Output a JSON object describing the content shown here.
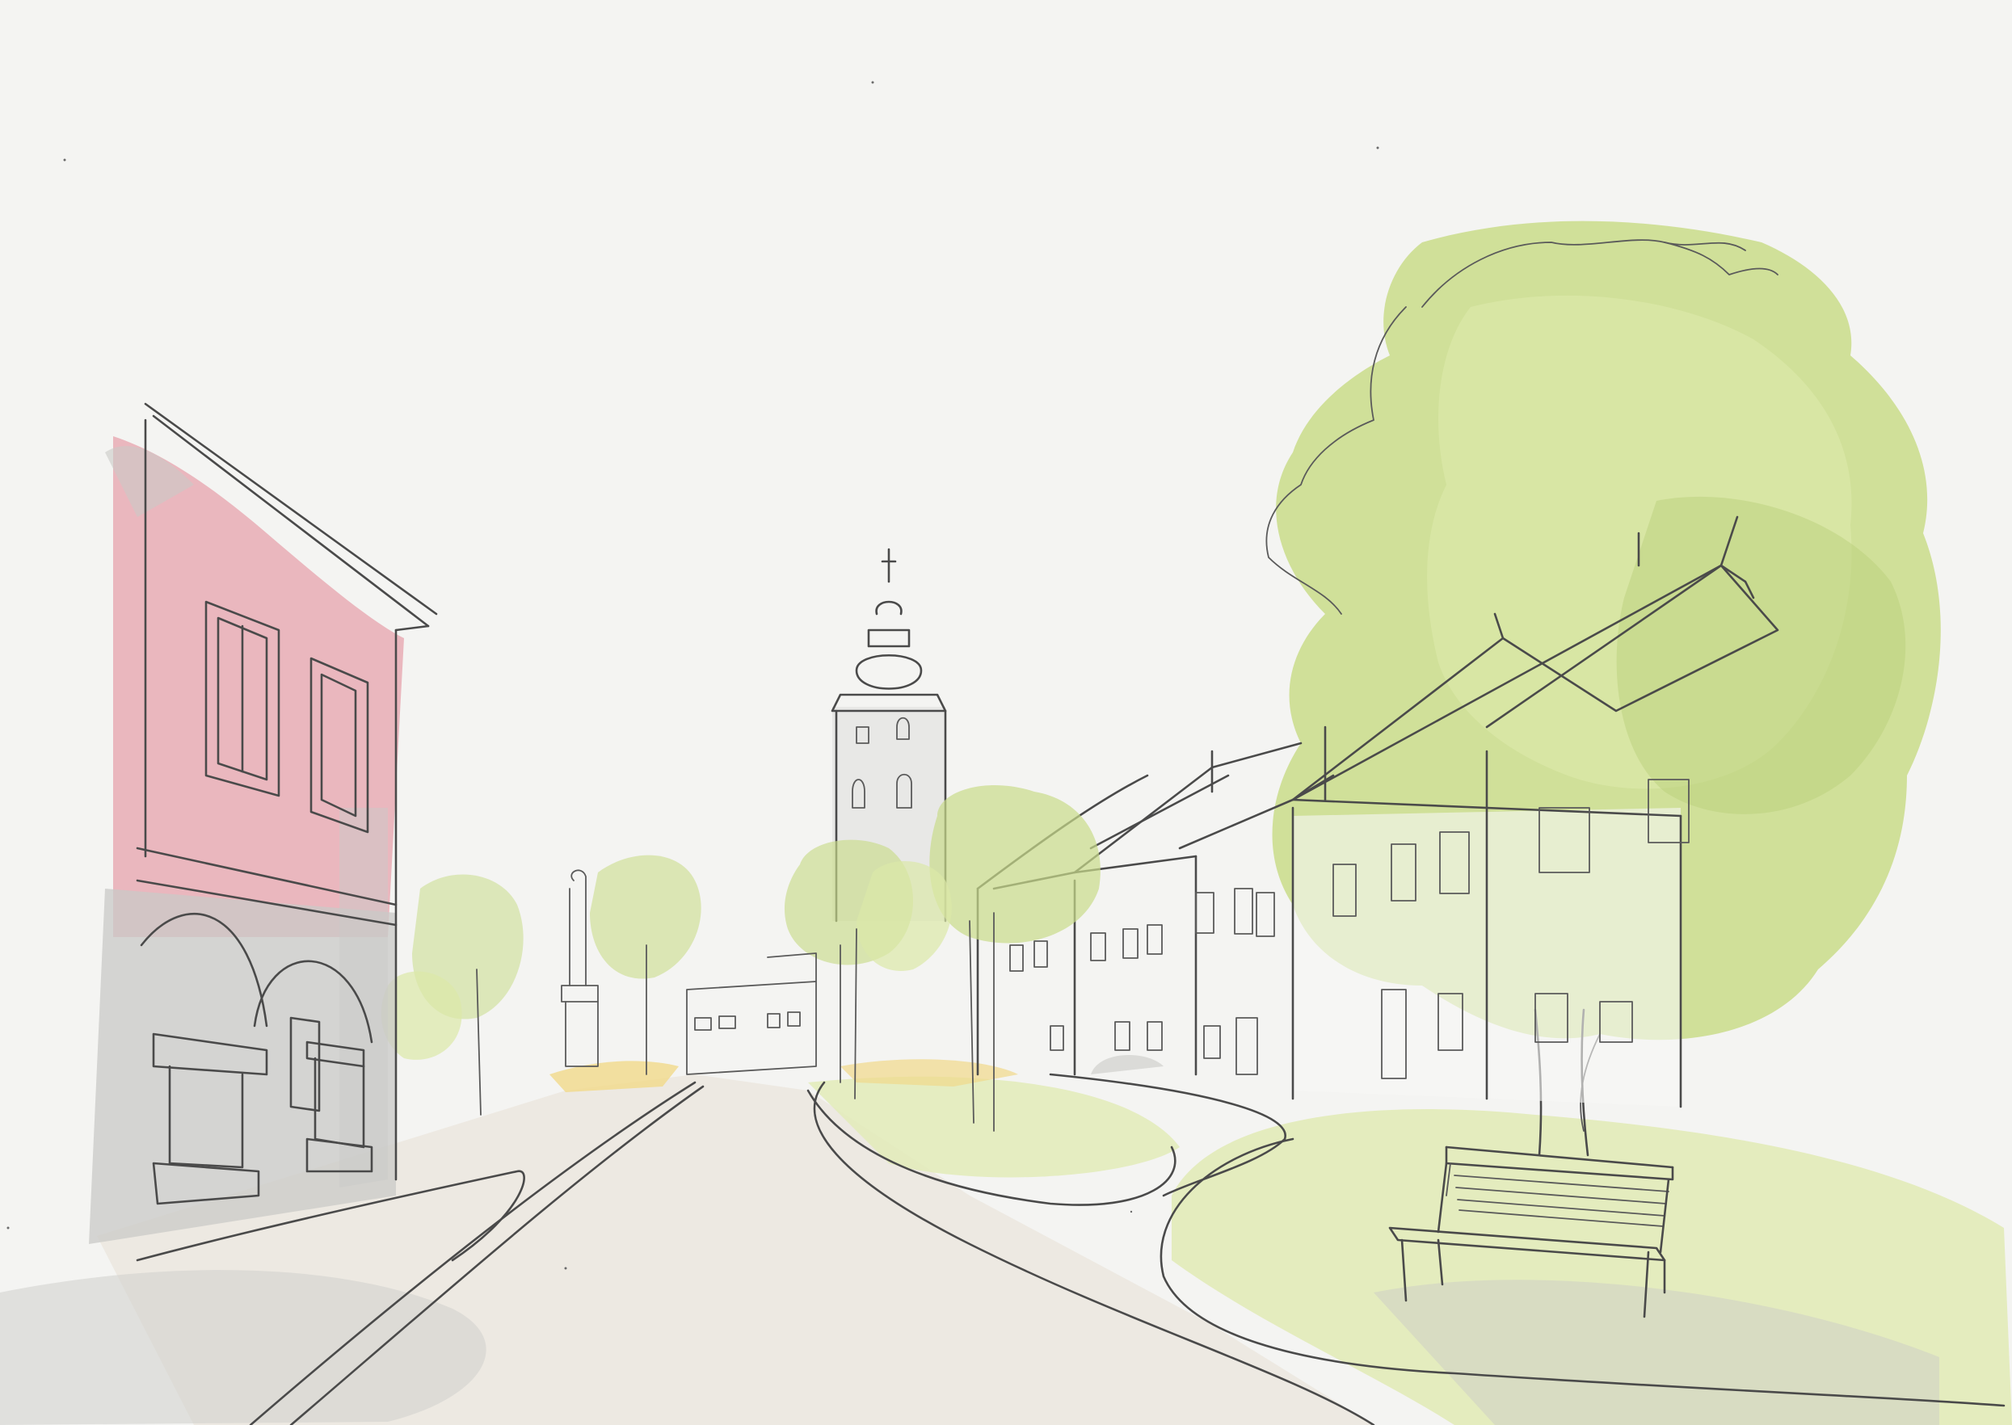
{
  "scene": {
    "subject": "sketch-town-square",
    "palette": {
      "paper": "#f4f4f2",
      "ink": "#4a4a4a",
      "tree_green": "#c9dc8a",
      "tree_green_light": "#dbe8a8",
      "facade_pink": "#e7a8b0",
      "shadow_grey": "#c9c9c7",
      "road_beige": "#ece8e0",
      "lawn_green": "#e2ebb8",
      "accent_yellow": "#f1d98a"
    }
  }
}
